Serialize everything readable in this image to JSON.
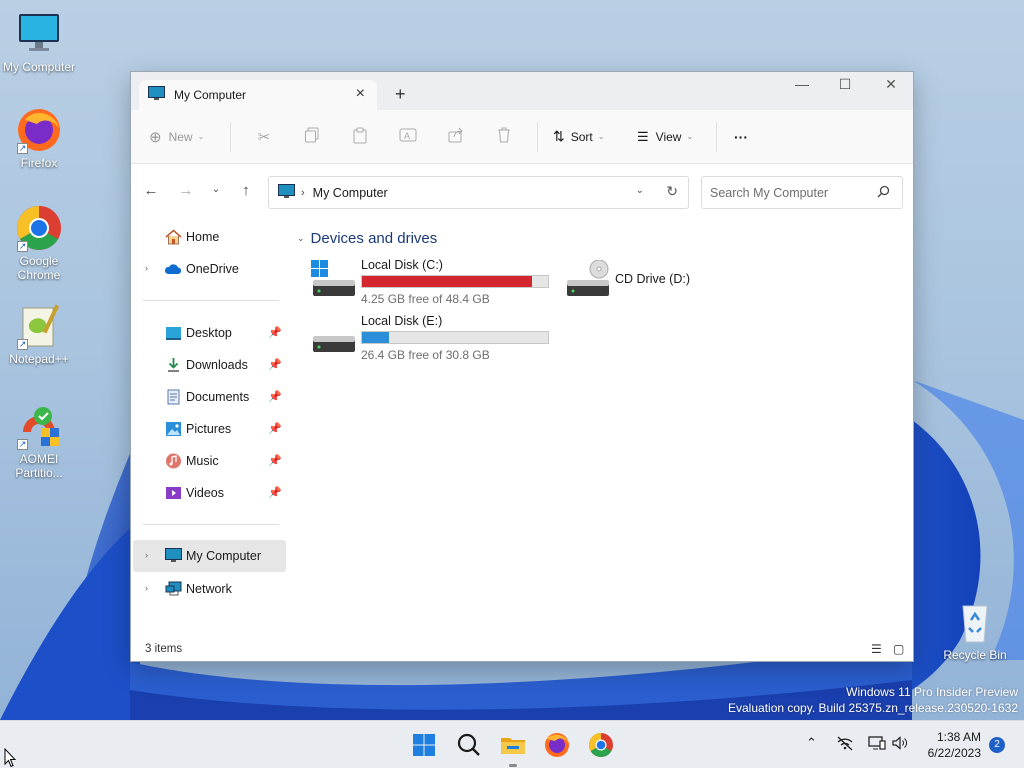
{
  "desktop": {
    "icons": [
      {
        "label": "My Computer"
      },
      {
        "label": "Firefox"
      },
      {
        "label": "Google Chrome"
      },
      {
        "label": "Notepad++"
      },
      {
        "label": "AOMEI Partitio..."
      },
      {
        "label": "Recycle Bin"
      }
    ]
  },
  "window": {
    "tab_title": "My Computer",
    "toolbar": {
      "new_label": "New",
      "sort_label": "Sort",
      "view_label": "View",
      "more_label": "···"
    },
    "address": {
      "crumb": "My Computer",
      "search_placeholder": "Search My Computer"
    },
    "sidebar": {
      "items": [
        {
          "label": "Home"
        },
        {
          "label": "OneDrive"
        },
        {
          "label": "Desktop"
        },
        {
          "label": "Downloads"
        },
        {
          "label": "Documents"
        },
        {
          "label": "Pictures"
        },
        {
          "label": "Music"
        },
        {
          "label": "Videos"
        },
        {
          "label": "My Computer"
        },
        {
          "label": "Network"
        }
      ]
    },
    "content": {
      "group_title": "Devices and drives",
      "drives": [
        {
          "name": "Local Disk (C:)",
          "free_text": "4.25 GB free of 48.4 GB",
          "used_fraction": 0.912,
          "bar_color": "#d3262f"
        },
        {
          "name": "CD Drive (D:)"
        },
        {
          "name": "Local Disk (E:)",
          "free_text": "26.4 GB free of 30.8 GB",
          "used_fraction": 0.143,
          "bar_color": "#2a8fd8"
        }
      ]
    },
    "status": {
      "items_text": "3 items"
    }
  },
  "watermark": {
    "line1": "Windows 11 Pro Insider Preview",
    "line2": "Evaluation copy. Build 25375.zn_release.230520-1632"
  },
  "taskbar": {
    "time": "1:38 AM",
    "date": "6/22/2023",
    "notification_count": "2"
  }
}
